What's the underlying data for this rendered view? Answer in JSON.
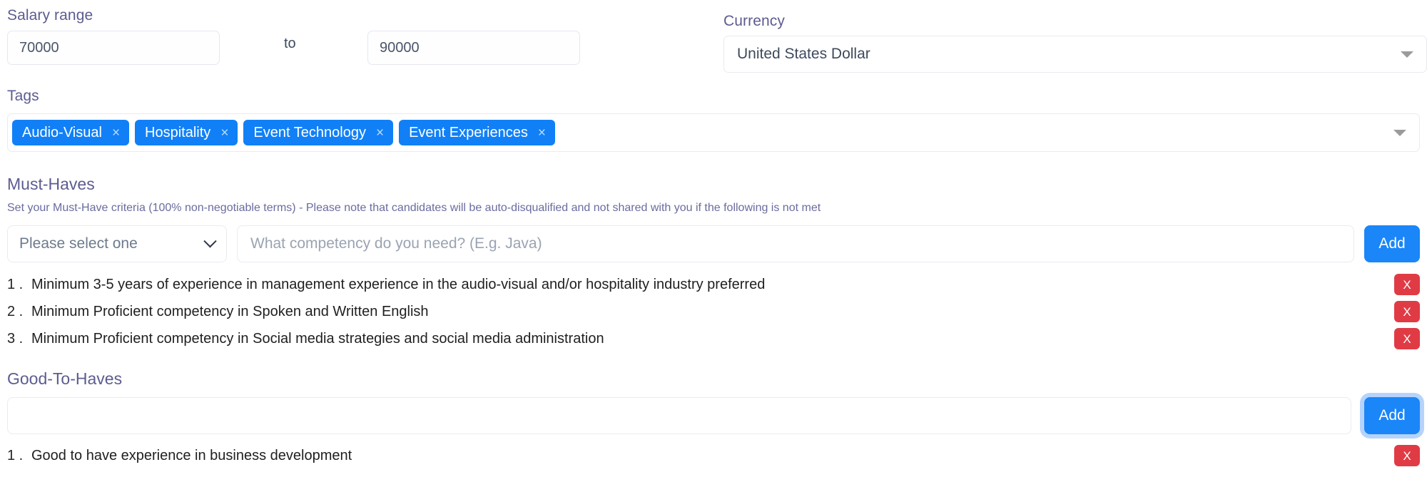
{
  "salary": {
    "label": "Salary range",
    "min_value": "70000",
    "min_placeholder": "",
    "separator": "to",
    "max_value": "90000",
    "max_placeholder": ""
  },
  "currency": {
    "label": "Currency",
    "selected": "United States Dollar",
    "caret_icon": "chevron-down-icon"
  },
  "tags": {
    "label": "Tags",
    "caret_icon": "chevron-down-icon",
    "remove_icon": "close-icon",
    "chips": [
      {
        "label": "Audio-Visual"
      },
      {
        "label": "Hospitality"
      },
      {
        "label": "Event Technology"
      },
      {
        "label": "Event Experiences"
      }
    ]
  },
  "must_haves": {
    "heading": "Must-Haves",
    "description": "Set your Must-Have criteria (100% non-negotiable terms) - Please note that candidates will be auto-disqualified and not shared with you if the following is not met",
    "select_value": "Please select one",
    "competency_placeholder": "What competency do you need? (E.g. Java)",
    "competency_value": "",
    "add_label": "Add",
    "remove_label": "X",
    "items": [
      {
        "number": "1 .",
        "text": "Minimum 3-5 years of experience in management experience in the audio-visual and/or hospitality industry preferred"
      },
      {
        "number": "2 .",
        "text": "Minimum Proficient competency in Spoken and Written English"
      },
      {
        "number": "3 .",
        "text": "Minimum Proficient competency in Social media strategies and social media administration"
      }
    ]
  },
  "good_to_haves": {
    "heading": "Good-To-Haves",
    "input_value": "",
    "input_placeholder": "",
    "add_label": "Add",
    "remove_label": "X",
    "items": [
      {
        "number": "1 .",
        "text": "Good to have experience in business development"
      }
    ]
  },
  "colors": {
    "label": "#5c5c90",
    "chip_blue": "#1180f7",
    "button_blue": "#1a86f8",
    "danger_red": "#e03b45",
    "border": "#e8ebf1"
  }
}
